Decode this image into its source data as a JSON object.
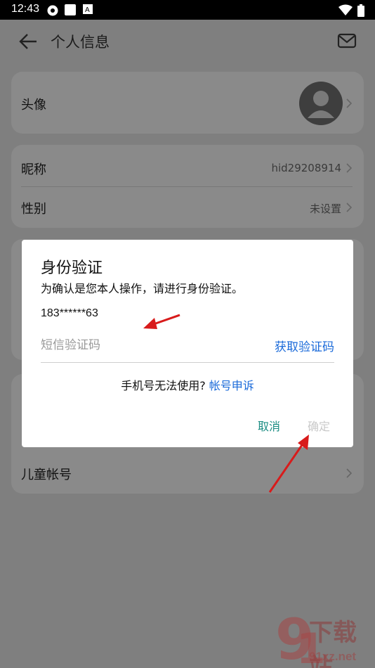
{
  "status_bar": {
    "time": "12:43"
  },
  "header": {
    "title": "个人信息"
  },
  "profile": {
    "avatar_label": "头像",
    "nickname_label": "昵称",
    "nickname_value": "hid29208914",
    "gender_label": "性别",
    "gender_value": "未设置",
    "child_account_label": "儿童帐号"
  },
  "dialog": {
    "title": "身份验证",
    "description": "为确认是您本人操作，请进行身份验证。",
    "phone": "183******63",
    "code_placeholder": "短信验证码",
    "get_code": "获取验证码",
    "help_text": "手机号无法使用?",
    "appeal_link": "帐号申诉",
    "cancel": "取消",
    "confirm": "确定"
  },
  "watermark": {
    "text": "下载站",
    "url": "91xz.net"
  },
  "colors": {
    "link": "#1a6ad9",
    "cancel": "#1a8c82",
    "disabled": "#c9c9c9",
    "annotation": "#d81b1b"
  }
}
